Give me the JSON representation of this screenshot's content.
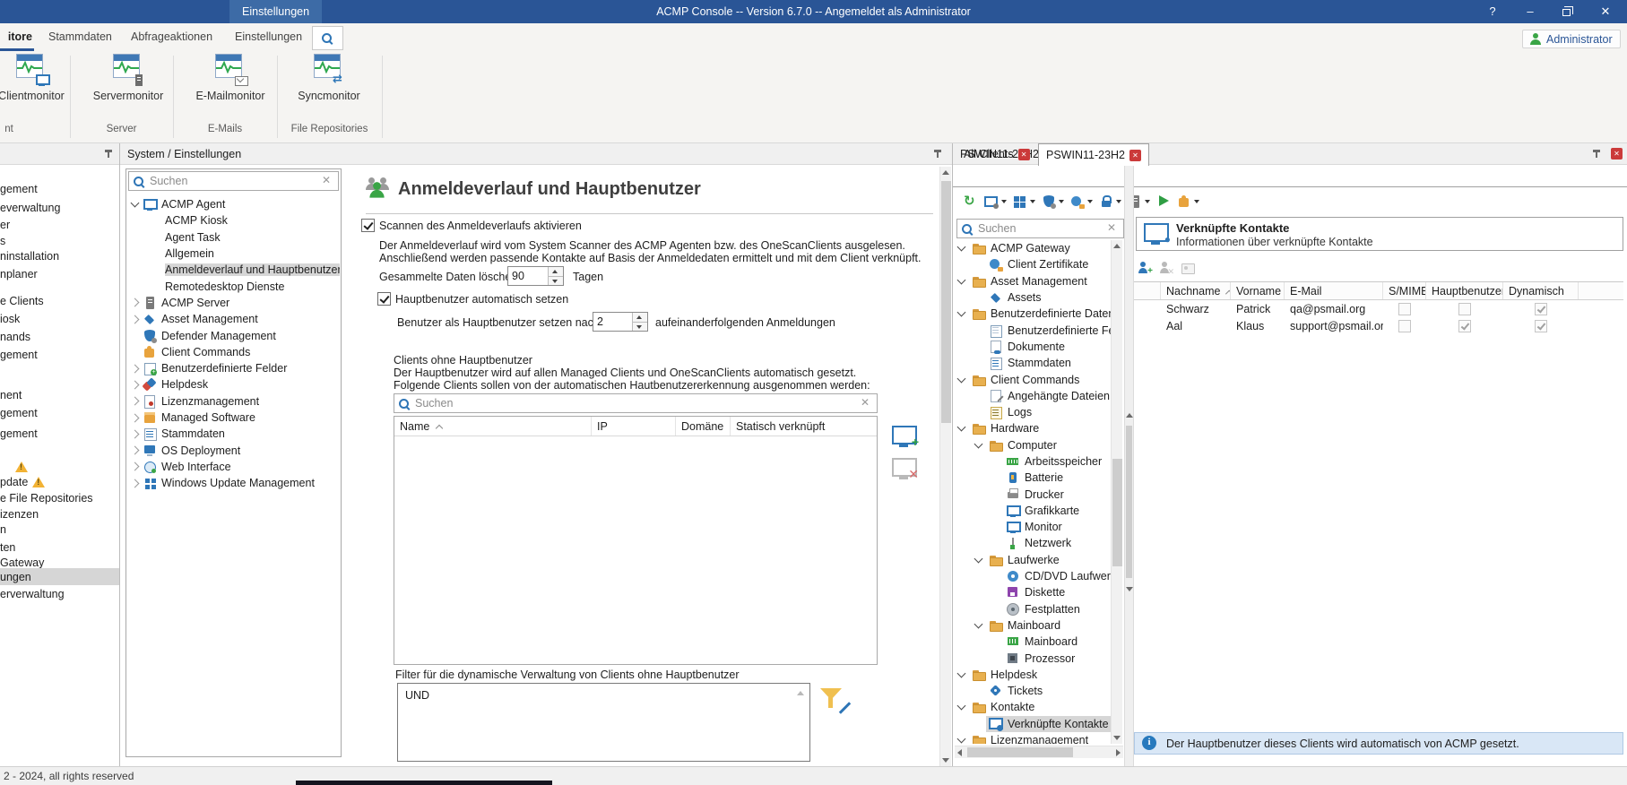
{
  "titlebar": {
    "context_tab": "Einstellungen",
    "title": "ACMP Console -- Version 6.7.0 -- Angemeldet als Administrator",
    "help_label": "?",
    "minimize_glyph": "–",
    "close_glyph": "✕"
  },
  "ribbon": {
    "tabs": [
      "itore",
      "Stammdaten",
      "Abfrageaktionen",
      "Einstellungen"
    ],
    "buttons": [
      "Clientmonitor",
      "Servermonitor",
      "E-Mailmonitor",
      "Syncmonitor"
    ],
    "group_labels": [
      "nt",
      "Server",
      "E-Mails",
      "File Repositories"
    ],
    "user_button": "Administrator"
  },
  "left_sidebar": {
    "items": [
      {
        "label": "gement"
      },
      {
        "label": "everwaltung"
      },
      {
        "label": "er"
      },
      {
        "label": "s"
      },
      {
        "label": "ninstallation"
      },
      {
        "label": "nplaner"
      },
      {
        "label": "e Clients"
      },
      {
        "label": "iosk"
      },
      {
        "label": "nands"
      },
      {
        "label": "gement"
      },
      {
        "label": "nent"
      },
      {
        "label": "gement"
      },
      {
        "label": "gement"
      },
      {
        "label": "",
        "warning": true
      },
      {
        "label": "pdate",
        "warning": true
      },
      {
        "label": "e File Repositories"
      },
      {
        "label": "izenzen"
      },
      {
        "label": "n"
      },
      {
        "label": "ten"
      },
      {
        "label": "Gateway"
      },
      {
        "label": "ungen",
        "selected": true
      },
      {
        "label": "erverwaltung"
      }
    ]
  },
  "middle_panel": {
    "header": "System / Einstellungen",
    "search_placeholder": "Suchen",
    "tree": [
      {
        "label": "ACMP Agent",
        "icon": "monitor",
        "level": 0,
        "expand": "v"
      },
      {
        "label": "ACMP Kiosk",
        "level": 1
      },
      {
        "label": "Agent Task",
        "level": 1
      },
      {
        "label": "Allgemein",
        "level": 1
      },
      {
        "label": "Anmeldeverlauf und Hauptbenutzer",
        "level": 1,
        "selected": true
      },
      {
        "label": "Remotedesktop Dienste",
        "level": 1
      },
      {
        "label": "ACMP Server",
        "icon": "server",
        "level": 0,
        "expand": ">"
      },
      {
        "label": "Asset Management",
        "icon": "diamond",
        "level": 0,
        "expand": ">"
      },
      {
        "label": "Defender Management",
        "icon": "shield",
        "level": 0
      },
      {
        "label": "Client Commands",
        "icon": "puzzle",
        "level": 0
      },
      {
        "label": "Benutzerdefinierte Felder",
        "icon": "table-plus",
        "level": 0,
        "expand": ">"
      },
      {
        "label": "Helpdesk",
        "icon": "tags",
        "level": 0,
        "expand": ">"
      },
      {
        "label": "Lizenzmanagement",
        "icon": "license",
        "level": 0,
        "expand": ">"
      },
      {
        "label": "Managed Software",
        "icon": "software",
        "level": 0,
        "expand": ">"
      },
      {
        "label": "Stammdaten",
        "icon": "list",
        "level": 0,
        "expand": ">"
      },
      {
        "label": "OS Deployment",
        "icon": "os",
        "level": 0,
        "expand": ">"
      },
      {
        "label": "Web Interface",
        "icon": "web",
        "level": 0,
        "expand": ">"
      },
      {
        "label": "Windows Update Management",
        "icon": "windows",
        "level": 0,
        "expand": ">"
      }
    ]
  },
  "settings": {
    "title": "Anmeldeverlauf und Hauptbenutzer",
    "scan_checkbox": "Scannen des Anmeldeverlaufs aktivieren",
    "scan_desc1": "Der Anmeldeverlauf wird vom System Scanner des ACMP Agenten bzw. des OneScanClients ausgelesen.",
    "scan_desc2": "Anschließend werden passende Kontakte auf Basis der Anmeldedaten ermittelt und mit dem Client verknüpft.",
    "delete_label": "Gesammelte Daten löschen nach",
    "delete_value": "90",
    "delete_unit": "Tagen",
    "mainuser_checkbox": "Hauptbenutzer automatisch setzen",
    "mainuser_label": "Benutzer als Hauptbenutzer setzen nach",
    "mainuser_value": "2",
    "mainuser_unit": "aufeinanderfolgenden Anmeldungen",
    "clients_title": "Clients ohne Hauptbenutzer",
    "clients_desc1": "Der Hauptbenutzer wird auf allen Managed Clients und OneScanClients automatisch gesetzt.",
    "clients_desc2": "Folgende Clients sollen von der automatischen Hautbenutzererkennung ausgenommen werden:",
    "search_placeholder": "Suchen",
    "table_columns": [
      "Name",
      "IP",
      "Domäne",
      "Statisch verknüpft"
    ],
    "filter_label": "Filter für die dynamische Verwaltung von Clients ohne Hauptbenutzer",
    "filter_value": "UND"
  },
  "client_panel": {
    "header": "PSWIN11-23H2",
    "tabs": [
      {
        "label": "All Clients"
      },
      {
        "label": "PSWIN11-23H2",
        "active": true
      }
    ],
    "search_placeholder": "Suchen",
    "tree": [
      {
        "label": "ACMP Gateway",
        "icon": "folder",
        "level": 0,
        "expand": "v"
      },
      {
        "label": "Client Zertifikate",
        "icon": "globe-lock",
        "level": 1
      },
      {
        "label": "Asset Management",
        "icon": "folder",
        "level": 0,
        "expand": "v"
      },
      {
        "label": "Assets",
        "icon": "diamond",
        "level": 1
      },
      {
        "label": "Benutzerdefinierte Daten",
        "icon": "folder",
        "level": 0,
        "expand": "v"
      },
      {
        "label": "Benutzerdefinierte Felder",
        "icon": "table",
        "level": 1
      },
      {
        "label": "Dokumente",
        "icon": "doc-link",
        "level": 1
      },
      {
        "label": "Stammdaten",
        "icon": "clipboard",
        "level": 1
      },
      {
        "label": "Client Commands",
        "icon": "folder",
        "level": 0,
        "expand": "v"
      },
      {
        "label": "Angehängte Dateien",
        "icon": "doc-clip",
        "level": 1
      },
      {
        "label": "Logs",
        "icon": "logs",
        "level": 1
      },
      {
        "label": "Hardware",
        "icon": "folder",
        "level": 0,
        "expand": "v"
      },
      {
        "label": "Computer",
        "icon": "folder",
        "level": 1,
        "expand": "v"
      },
      {
        "label": "Arbeitsspeicher",
        "icon": "ram",
        "level": 2
      },
      {
        "label": "Batterie",
        "icon": "battery",
        "level": 2
      },
      {
        "label": "Drucker",
        "icon": "printer",
        "level": 2
      },
      {
        "label": "Grafikkarte",
        "icon": "monitor",
        "level": 2
      },
      {
        "label": "Monitor",
        "icon": "monitor",
        "level": 2
      },
      {
        "label": "Netzwerk",
        "icon": "network",
        "level": 2
      },
      {
        "label": "Laufwerke",
        "icon": "folder",
        "level": 1,
        "expand": "v"
      },
      {
        "label": "CD/DVD Laufwerke",
        "icon": "cd",
        "level": 2
      },
      {
        "label": "Diskette",
        "icon": "floppy",
        "level": 2
      },
      {
        "label": "Festplatten",
        "icon": "hdd",
        "level": 2
      },
      {
        "label": "Mainboard",
        "icon": "folder",
        "level": 1,
        "expand": "v"
      },
      {
        "label": "Mainboard",
        "icon": "chip",
        "level": 2
      },
      {
        "label": "Prozessor",
        "icon": "cpu",
        "level": 2
      },
      {
        "label": "Helpdesk",
        "icon": "folder",
        "level": 0,
        "expand": "v"
      },
      {
        "label": "Tickets",
        "icon": "ticket",
        "level": 1
      },
      {
        "label": "Kontakte",
        "icon": "folder",
        "level": 0,
        "expand": "v"
      },
      {
        "label": "Verknüpfte Kontakte",
        "icon": "contact-monitor",
        "level": 1,
        "selected": true
      },
      {
        "label": "Lizenzmanagement",
        "icon": "folder",
        "level": 0,
        "expand": "v"
      }
    ],
    "detail": {
      "title": "Verknüpfte Kontakte",
      "subtitle": "Informationen über verknüpfte Kontakte",
      "columns": [
        "Nachname",
        "Vorname",
        "E-Mail",
        "S/MIME",
        "Hauptbenutzer",
        "Dynamisch"
      ],
      "rows": [
        {
          "nachname": "Schwarz",
          "vorname": "Patrick",
          "email": "qa@psmail.org",
          "smime": false,
          "hauptbenutzer": false,
          "dynamisch": true
        },
        {
          "nachname": "Aal",
          "vorname": "Klaus",
          "email": "support@psmail.org",
          "smime": false,
          "hauptbenutzer": true,
          "dynamisch": true
        }
      ],
      "info": "Der Hauptbenutzer dieses Clients wird automatisch von ACMP gesetzt."
    }
  },
  "statusbar": {
    "text": "2 - 2024, all rights reserved"
  }
}
